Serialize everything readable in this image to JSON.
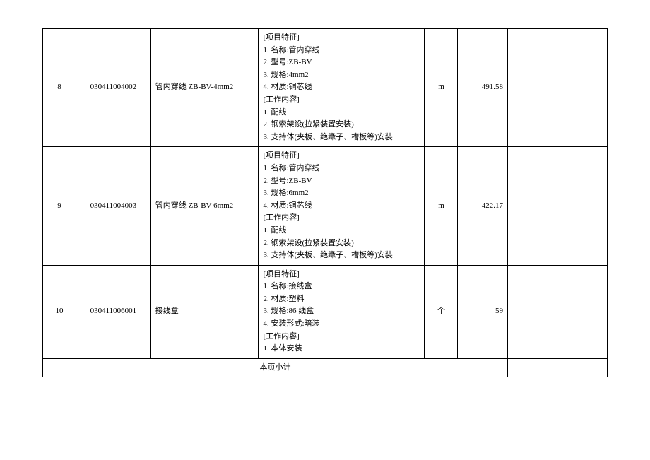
{
  "rows": [
    {
      "seq": "8",
      "code": "030411004002",
      "name": "管内穿线 ZB-BV-4mm2",
      "spec": "[项目特征]\n1. 名称:管内穿线\n2. 型号:ZB-BV\n3. 规格:4mm2\n4. 材质:铜芯线\n[工作内容]\n1. 配线\n2. 钢索架设(拉紧装置安装)\n3. 支持体(夹板、绝缘子、槽板等)安装",
      "unit": "m",
      "qty": "491.58"
    },
    {
      "seq": "9",
      "code": "030411004003",
      "name": "管内穿线 ZB-BV-6mm2",
      "spec": "[项目特征]\n1. 名称:管内穿线\n2. 型号:ZB-BV\n3. 规格:6mm2\n4. 材质:铜芯线\n[工作内容]\n1. 配线\n2. 钢索架设(拉紧装置安装)\n3. 支持体(夹板、绝缘子、槽板等)安装",
      "unit": "m",
      "qty": "422.17"
    },
    {
      "seq": "10",
      "code": "030411006001",
      "name": "接线盒",
      "spec": "[项目特征]\n1. 名称:接线盒\n2. 材质:塑料\n3. 规格:86 线盒\n4. 安装形式:暗装\n[工作内容]\n1. 本体安装",
      "unit": "个",
      "qty": "59"
    }
  ],
  "subtotal_label": "本页小计"
}
